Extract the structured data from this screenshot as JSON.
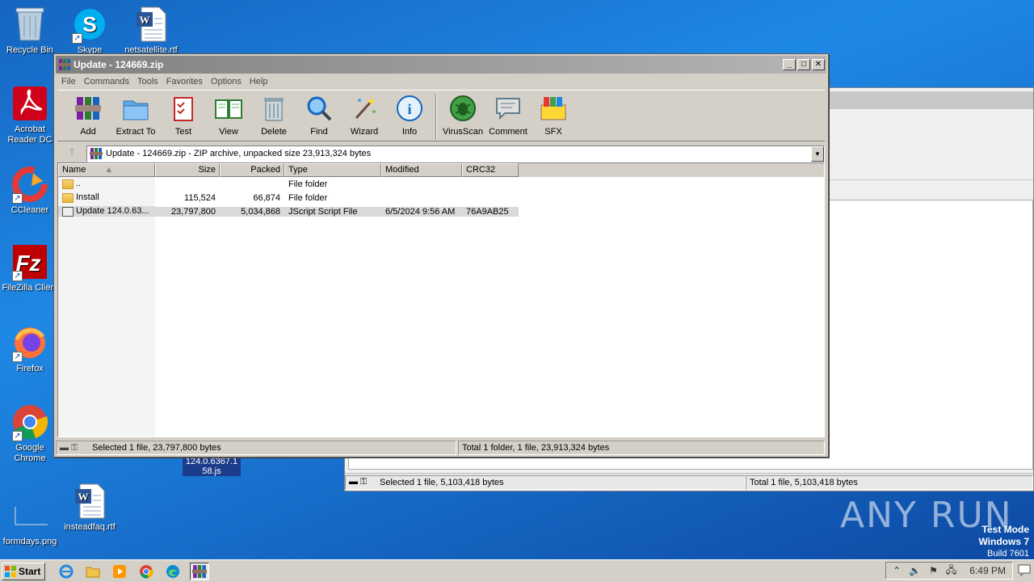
{
  "desktop": {
    "icons": [
      {
        "label": "Recycle Bin"
      },
      {
        "label": "Skype"
      },
      {
        "label": "netsatellite.rtf"
      },
      {
        "label": "Acrobat Reader DC"
      },
      {
        "label": "CCleaner"
      },
      {
        "label": "FileZilla Client"
      },
      {
        "label": "Firefox"
      },
      {
        "label": "Google Chrome"
      },
      {
        "label": "formdays.png"
      },
      {
        "label": "insteadfaq.rtf"
      }
    ],
    "selected_file_label_line1": "124.0.6367.1",
    "selected_file_label_line2": "58.js"
  },
  "window": {
    "title": "Update - 124669.zip",
    "menu": [
      "File",
      "Commands",
      "Tools",
      "Favorites",
      "Options",
      "Help"
    ],
    "toolbar": [
      "Add",
      "Extract To",
      "Test",
      "View",
      "Delete",
      "Find",
      "Wizard",
      "Info",
      "VirusScan",
      "Comment",
      "SFX"
    ],
    "address": "Update - 124669.zip - ZIP archive, unpacked size 23,913,324 bytes",
    "columns": [
      "Name",
      "Size",
      "Packed",
      "Type",
      "Modified",
      "CRC32"
    ],
    "rows": [
      {
        "name": "..",
        "size": "",
        "packed": "",
        "type": "File folder",
        "modified": "",
        "crc": ""
      },
      {
        "name": "Install",
        "size": "115,524",
        "packed": "66,874",
        "type": "File folder",
        "modified": "",
        "crc": ""
      },
      {
        "name": "Update 124.0.63...",
        "size": "23,797,800",
        "packed": "5,034,868",
        "type": "JScript Script File",
        "modified": "6/5/2024 9:56 AM",
        "crc": "76A9AB25"
      }
    ],
    "status_left": "Selected 1 file, 23,797,800 bytes",
    "status_right": "Total 1 folder, 1 file, 23,913,324 bytes"
  },
  "bg_window": {
    "status_left": "Selected 1 file, 5,103,418 bytes",
    "status_right": "Total 1 file, 5,103,418 bytes"
  },
  "watermark": "ANY RUN",
  "testmode": {
    "line1": "Test Mode",
    "line2": "Windows 7",
    "line3": "Build 7601"
  },
  "taskbar": {
    "start": "Start",
    "clock": "6:49 PM"
  }
}
